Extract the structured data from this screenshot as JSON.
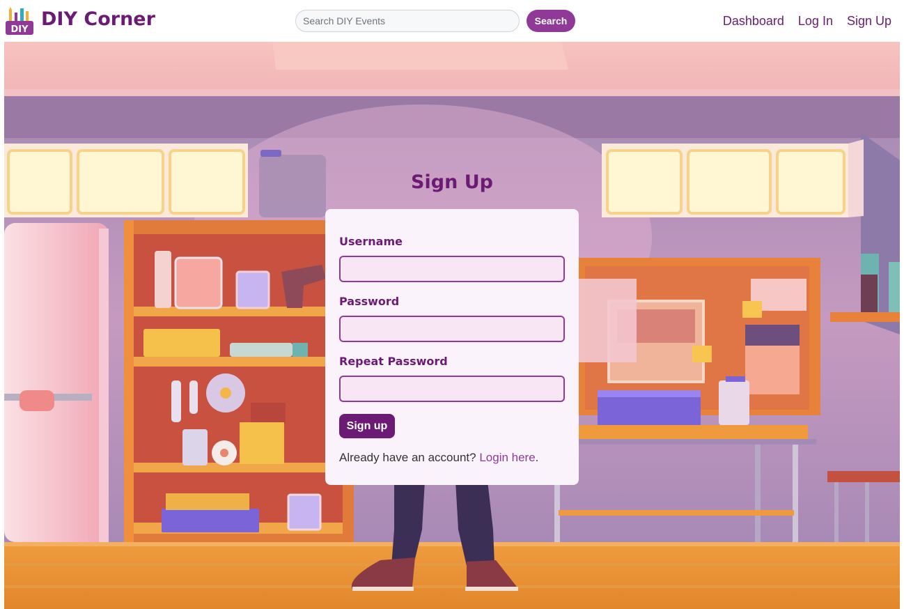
{
  "navbar": {
    "brand": "DIY Corner",
    "logo_badge": "DIY",
    "search_placeholder": "Search DIY Events",
    "search_button": "Search",
    "links": [
      "Dashboard",
      "Log In",
      "Sign Up"
    ]
  },
  "form": {
    "title": "Sign Up",
    "username_label": "Username",
    "password_label": "Password",
    "repeat_password_label": "Repeat Password",
    "username_value": "",
    "password_value": "",
    "repeat_password_value": "",
    "submit_label": "Sign up",
    "already_text": "Already have an account?",
    "login_link": "Login here",
    "trailing_period": "."
  },
  "colors": {
    "brand": "#6b1b74",
    "accent": "#8e3a96",
    "card_bg": "#fbf3fb",
    "input_bg": "#f9e6f4"
  },
  "icons": {
    "logo": "diy-tools-logo-icon"
  }
}
